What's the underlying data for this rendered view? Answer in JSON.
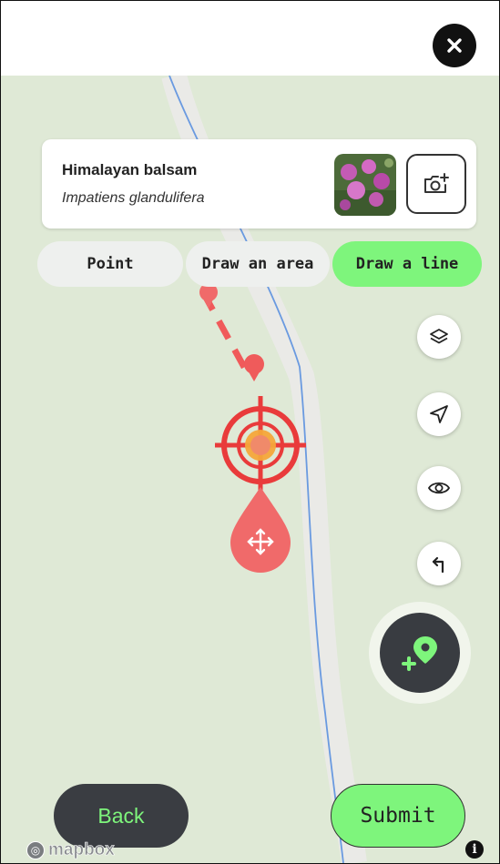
{
  "close": {
    "icon": "close-icon"
  },
  "species": {
    "common_name": "Himalayan balsam",
    "latin_name": "Impatiens glandulifera",
    "photo_icon": "flower-photo",
    "camera_icon": "camera-add-icon"
  },
  "modes": [
    {
      "label": "Point",
      "active": false
    },
    {
      "label": "Draw an area",
      "active": false
    },
    {
      "label": "Draw a line",
      "active": true
    }
  ],
  "tools": [
    {
      "icon": "layers-icon"
    },
    {
      "icon": "navigation-icon"
    },
    {
      "icon": "eye-icon"
    },
    {
      "icon": "undo-icon"
    }
  ],
  "add_point": {
    "icon": "add-location-icon"
  },
  "footer": {
    "back_label": "Back",
    "submit_label": "Submit"
  },
  "mapbox": {
    "logo_text": "mapbox",
    "info_icon": "i"
  },
  "colors": {
    "accent_green": "#7ef57c",
    "dark": "#393c41",
    "marker_red": "#f06a6a",
    "map_bg": "#dfe9d6"
  }
}
